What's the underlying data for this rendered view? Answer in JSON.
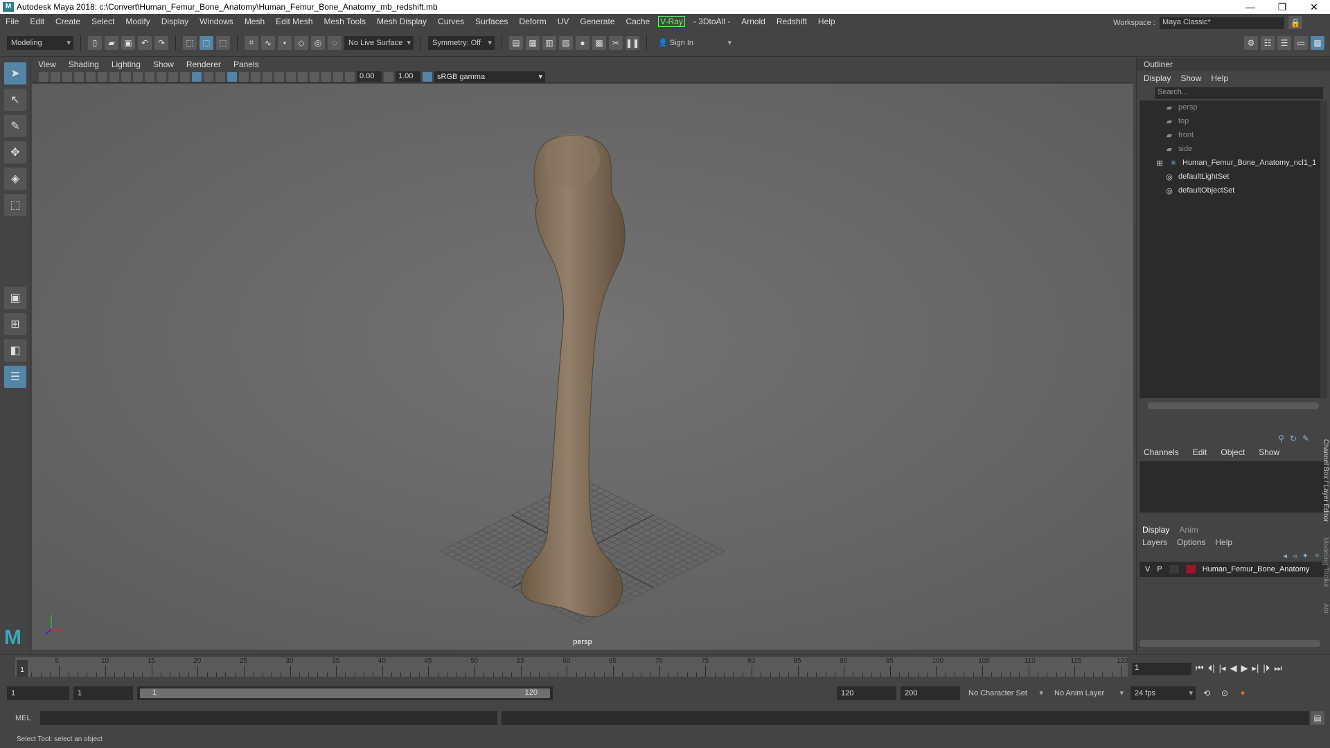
{
  "titlebar": {
    "title": "Autodesk Maya 2018: c:\\Convert\\Human_Femur_Bone_Anatomy\\Human_Femur_Bone_Anatomy_mb_redshift.mb",
    "minimize": "—",
    "restore": "❐",
    "close": "✕"
  },
  "menu": [
    "File",
    "Edit",
    "Create",
    "Select",
    "Modify",
    "Display",
    "Windows",
    "Mesh",
    "Edit Mesh",
    "Mesh Tools",
    "Mesh Display",
    "Curves",
    "Surfaces",
    "Deform",
    "UV",
    "Generate",
    "Cache",
    "V-Ray",
    "- 3DtoAll -",
    "Arnold",
    "Redshift",
    "Help"
  ],
  "workspace": {
    "label": "Workspace :",
    "value": "Maya Classic*"
  },
  "shelf": {
    "mode": "Modeling",
    "live_surface": "No Live Surface",
    "symmetry": "Symmetry: Off",
    "sign_in": "Sign In"
  },
  "viewport": {
    "menu": [
      "View",
      "Shading",
      "Lighting",
      "Show",
      "Renderer",
      "Panels"
    ],
    "exposure": "0.00",
    "gamma_value": "1.00",
    "color_space": "sRGB gamma",
    "camera_label": "persp"
  },
  "outliner": {
    "title": "Outliner",
    "menus": [
      "Display",
      "Show",
      "Help"
    ],
    "search_placeholder": "Search...",
    "items": [
      {
        "label": "persp",
        "icon": "camera-icon"
      },
      {
        "label": "top",
        "icon": "camera-icon"
      },
      {
        "label": "front",
        "icon": "camera-icon"
      },
      {
        "label": "side",
        "icon": "camera-icon"
      },
      {
        "label": "Human_Femur_Bone_Anatomy_ncl1_1",
        "icon": "transform-icon"
      },
      {
        "label": "defaultLightSet",
        "icon": "set-icon"
      },
      {
        "label": "defaultObjectSet",
        "icon": "set-icon"
      }
    ]
  },
  "channelbox": {
    "menus": [
      "Channels",
      "Edit",
      "Object",
      "Show"
    ],
    "side_label": "Channel Box / Layer Editor",
    "side_label2": "Modeling Toolkit",
    "side_label3": "Attr",
    "layer_tabs": [
      "Display",
      "Anim"
    ],
    "layer_menus": [
      "Layers",
      "Options",
      "Help"
    ],
    "layer": {
      "v": "V",
      "p": "P",
      "name": "Human_Femur_Bone_Anatomy",
      "color": "#a0132a"
    }
  },
  "timeline": {
    "ticks": [
      "5",
      "10",
      "15",
      "20",
      "25",
      "30",
      "35",
      "40",
      "45",
      "50",
      "55",
      "60",
      "65",
      "70",
      "75",
      "80",
      "85",
      "90",
      "95",
      "100",
      "105",
      "110",
      "115",
      "120"
    ],
    "start_marker": "1",
    "current_frame": "1"
  },
  "range": {
    "start": "1",
    "inner_start": "1",
    "slider_start": "1",
    "slider_end": "120",
    "end": "120",
    "max": "200",
    "char_set": "No Character Set",
    "anim_layer": "No Anim Layer",
    "fps": "24 fps"
  },
  "cmd": {
    "label": "MEL"
  },
  "help": {
    "text": "Select Tool: select an object"
  }
}
